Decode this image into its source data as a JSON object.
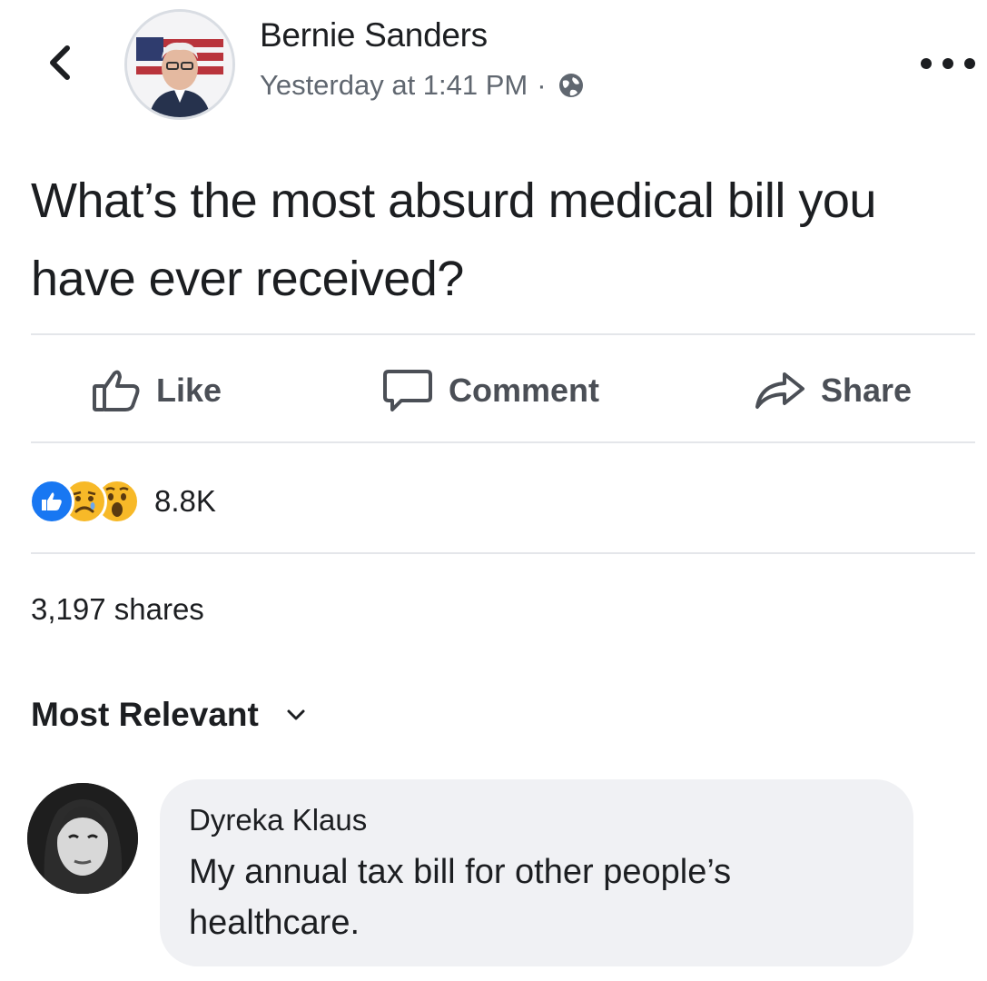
{
  "post": {
    "author": "Bernie Sanders",
    "timestamp": "Yesterday at 1:41 PM",
    "separator": "·",
    "privacy_icon": "globe-icon",
    "text": "What’s the most absurd medical bill you have ever received?"
  },
  "actions": {
    "like_label": "Like",
    "comment_label": "Comment",
    "share_label": "Share"
  },
  "reactions": {
    "icons": [
      "like-reaction-icon",
      "sad-reaction-icon",
      "wow-reaction-icon"
    ],
    "count": "8.8K"
  },
  "shares": "3,197 shares",
  "comments": {
    "sort_label": "Most Relevant",
    "items": [
      {
        "name": "Dyreka Klaus",
        "text": "My annual tax bill for other people’s healthcare."
      }
    ]
  },
  "colors": {
    "text": "#1c1e21",
    "secondary": "#606770",
    "like_blue": "#1877f2",
    "reaction_yellow": "#f7b928",
    "bubble": "#f0f1f4",
    "divider": "#e4e6ea"
  }
}
